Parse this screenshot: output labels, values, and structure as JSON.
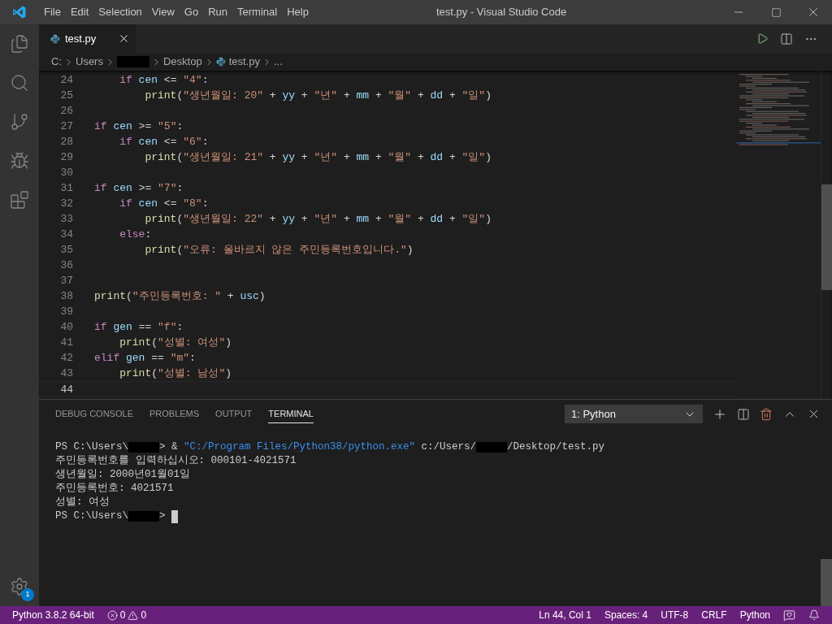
{
  "window": {
    "title": "test.py - Visual Studio Code"
  },
  "menu": [
    "File",
    "Edit",
    "Selection",
    "View",
    "Go",
    "Run",
    "Terminal",
    "Help"
  ],
  "activity_bar": {
    "items": [
      {
        "kind": "explorer"
      },
      {
        "kind": "search"
      },
      {
        "kind": "source_control"
      },
      {
        "kind": "run"
      },
      {
        "kind": "extensions"
      }
    ],
    "settings_badge": "1"
  },
  "editor_tabs": [
    {
      "label": "test.py",
      "selected": true
    }
  ],
  "breadcrumb": [
    {
      "kind": "text",
      "text": "C:"
    },
    {
      "kind": "text",
      "text": "Users"
    },
    {
      "kind": "redacted"
    },
    {
      "kind": "text",
      "text": "Desktop"
    },
    {
      "kind": "file",
      "text": "test.py"
    },
    {
      "kind": "text",
      "text": "..."
    }
  ],
  "code": [
    {
      "number": "24",
      "tokens": [
        {
          "kind": "indent"
        },
        {
          "kind": "keyword",
          "text": "if"
        },
        {
          "kind": "var",
          "text": " cen "
        },
        {
          "kind": "plain",
          "text": "<= "
        },
        {
          "kind": "string",
          "text": "\"4\""
        },
        {
          "kind": "plain",
          "text": ":"
        }
      ]
    },
    {
      "number": "25",
      "tokens": [
        {
          "kind": "indent"
        },
        {
          "kind": "indent"
        },
        {
          "kind": "func",
          "text": "print"
        },
        {
          "kind": "plain",
          "text": "("
        },
        {
          "kind": "string",
          "text": "\"생년월일: 20\""
        },
        {
          "kind": "plain",
          "text": " + "
        },
        {
          "kind": "var",
          "text": "yy"
        },
        {
          "kind": "plain",
          "text": " + "
        },
        {
          "kind": "string",
          "text": "\"년\""
        },
        {
          "kind": "plain",
          "text": " + "
        },
        {
          "kind": "var",
          "text": "mm"
        },
        {
          "kind": "plain",
          "text": " + "
        },
        {
          "kind": "string",
          "text": "\"월\""
        },
        {
          "kind": "plain",
          "text": " + "
        },
        {
          "kind": "var",
          "text": "dd"
        },
        {
          "kind": "plain",
          "text": " + "
        },
        {
          "kind": "string",
          "text": "\"일\""
        },
        {
          "kind": "plain",
          "text": ")"
        }
      ]
    },
    {
      "number": "26"
    },
    {
      "number": "27",
      "tokens": [
        {
          "kind": "keyword",
          "text": "if"
        },
        {
          "kind": "var",
          "text": " cen "
        },
        {
          "kind": "plain",
          "text": ">= "
        },
        {
          "kind": "string",
          "text": "\"5\""
        },
        {
          "kind": "plain",
          "text": ":"
        }
      ]
    },
    {
      "number": "28",
      "tokens": [
        {
          "kind": "indent"
        },
        {
          "kind": "keyword",
          "text": "if"
        },
        {
          "kind": "var",
          "text": " cen "
        },
        {
          "kind": "plain",
          "text": "<= "
        },
        {
          "kind": "string",
          "text": "\"6\""
        },
        {
          "kind": "plain",
          "text": ":"
        }
      ]
    },
    {
      "number": "29",
      "tokens": [
        {
          "kind": "indent"
        },
        {
          "kind": "indent"
        },
        {
          "kind": "func",
          "text": "print"
        },
        {
          "kind": "plain",
          "text": "("
        },
        {
          "kind": "string",
          "text": "\"생년월일: 21\""
        },
        {
          "kind": "plain",
          "text": " + "
        },
        {
          "kind": "var",
          "text": "yy"
        },
        {
          "kind": "plain",
          "text": " + "
        },
        {
          "kind": "string",
          "text": "\"년\""
        },
        {
          "kind": "plain",
          "text": " + "
        },
        {
          "kind": "var",
          "text": "mm"
        },
        {
          "kind": "plain",
          "text": " + "
        },
        {
          "kind": "string",
          "text": "\"월\""
        },
        {
          "kind": "plain",
          "text": " + "
        },
        {
          "kind": "var",
          "text": "dd"
        },
        {
          "kind": "plain",
          "text": " + "
        },
        {
          "kind": "string",
          "text": "\"일\""
        },
        {
          "kind": "plain",
          "text": ")"
        }
      ]
    },
    {
      "number": "30"
    },
    {
      "number": "31",
      "tokens": [
        {
          "kind": "keyword",
          "text": "if"
        },
        {
          "kind": "var",
          "text": " cen "
        },
        {
          "kind": "plain",
          "text": ">= "
        },
        {
          "kind": "string",
          "text": "\"7\""
        },
        {
          "kind": "plain",
          "text": ":"
        }
      ]
    },
    {
      "number": "32",
      "tokens": [
        {
          "kind": "indent"
        },
        {
          "kind": "keyword",
          "text": "if"
        },
        {
          "kind": "var",
          "text": " cen "
        },
        {
          "kind": "plain",
          "text": "<= "
        },
        {
          "kind": "string",
          "text": "\"8\""
        },
        {
          "kind": "plain",
          "text": ":"
        }
      ]
    },
    {
      "number": "33",
      "tokens": [
        {
          "kind": "indent"
        },
        {
          "kind": "indent"
        },
        {
          "kind": "func",
          "text": "print"
        },
        {
          "kind": "plain",
          "text": "("
        },
        {
          "kind": "string",
          "text": "\"생년월일: 22\""
        },
        {
          "kind": "plain",
          "text": " + "
        },
        {
          "kind": "var",
          "text": "yy"
        },
        {
          "kind": "plain",
          "text": " + "
        },
        {
          "kind": "string",
          "text": "\"년\""
        },
        {
          "kind": "plain",
          "text": " + "
        },
        {
          "kind": "var",
          "text": "mm"
        },
        {
          "kind": "plain",
          "text": " + "
        },
        {
          "kind": "string",
          "text": "\"월\""
        },
        {
          "kind": "plain",
          "text": " + "
        },
        {
          "kind": "var",
          "text": "dd"
        },
        {
          "kind": "plain",
          "text": " + "
        },
        {
          "kind": "string",
          "text": "\"일\""
        },
        {
          "kind": "plain",
          "text": ")"
        }
      ]
    },
    {
      "number": "34",
      "tokens": [
        {
          "kind": "indent"
        },
        {
          "kind": "keyword",
          "text": "else"
        },
        {
          "kind": "plain",
          "text": ":"
        }
      ]
    },
    {
      "number": "35",
      "tokens": [
        {
          "kind": "indent"
        },
        {
          "kind": "indent"
        },
        {
          "kind": "func",
          "text": "print"
        },
        {
          "kind": "plain",
          "text": "("
        },
        {
          "kind": "string",
          "text": "\"오류: 올바르지 않은 주민등록번호입니다.\""
        },
        {
          "kind": "plain",
          "text": ")"
        }
      ]
    },
    {
      "number": "36"
    },
    {
      "number": "37"
    },
    {
      "number": "38",
      "tokens": [
        {
          "kind": "func",
          "text": "print"
        },
        {
          "kind": "plain",
          "text": "("
        },
        {
          "kind": "string",
          "text": "\"주민등록번호: \""
        },
        {
          "kind": "plain",
          "text": " + "
        },
        {
          "kind": "var",
          "text": "usc"
        },
        {
          "kind": "plain",
          "text": ")"
        }
      ]
    },
    {
      "number": "39"
    },
    {
      "number": "40",
      "tokens": [
        {
          "kind": "keyword",
          "text": "if"
        },
        {
          "kind": "var",
          "text": " gen "
        },
        {
          "kind": "plain",
          "text": "== "
        },
        {
          "kind": "string",
          "text": "\"f\""
        },
        {
          "kind": "plain",
          "text": ":"
        }
      ]
    },
    {
      "number": "41",
      "tokens": [
        {
          "kind": "indent"
        },
        {
          "kind": "func",
          "text": "print"
        },
        {
          "kind": "plain",
          "text": "("
        },
        {
          "kind": "string",
          "text": "\"성별: 여성\""
        },
        {
          "kind": "plain",
          "text": ")"
        }
      ]
    },
    {
      "number": "42",
      "tokens": [
        {
          "kind": "keyword",
          "text": "elif"
        },
        {
          "kind": "var",
          "text": " gen "
        },
        {
          "kind": "plain",
          "text": "== "
        },
        {
          "kind": "string",
          "text": "\"m\""
        },
        {
          "kind": "plain",
          "text": ":"
        }
      ]
    },
    {
      "number": "43",
      "tokens": [
        {
          "kind": "indent"
        },
        {
          "kind": "func",
          "text": "print"
        },
        {
          "kind": "plain",
          "text": "("
        },
        {
          "kind": "string",
          "text": "\"성별: 남성\""
        },
        {
          "kind": "plain",
          "text": ")"
        }
      ]
    },
    {
      "number": "44",
      "current": true
    }
  ],
  "panel": {
    "tabs": [
      {
        "label": "DEBUG CONSOLE",
        "selected": false
      },
      {
        "label": "PROBLEMS",
        "selected": false
      },
      {
        "label": "OUTPUT",
        "selected": false
      },
      {
        "label": "TERMINAL",
        "selected": true
      }
    ],
    "terminal_select": "1: Python",
    "terminal": [
      [
        {
          "kind": "text",
          "text": "PS C:\\Users\\"
        },
        {
          "kind": "redacted"
        },
        {
          "kind": "text",
          "text": "> & "
        },
        {
          "kind": "string",
          "text": "\"C:/Program Files/Python38/python.exe\""
        },
        {
          "kind": "text",
          "text": " c:/Users/"
        },
        {
          "kind": "redacted"
        },
        {
          "kind": "text",
          "text": "/Desktop/test.py"
        }
      ],
      [
        {
          "kind": "text",
          "text": "주민등록번호를 입력하십시오: 000101-4021571"
        }
      ],
      [
        {
          "kind": "text",
          "text": "생년월일: 2000년01월01일"
        }
      ],
      [
        {
          "kind": "text",
          "text": "주민등록번호: 4021571"
        }
      ],
      [
        {
          "kind": "text",
          "text": "성별: 여성"
        }
      ],
      [
        {
          "kind": "text",
          "text": "PS C:\\Users\\"
        },
        {
          "kind": "redacted"
        },
        {
          "kind": "text",
          "text": "> "
        },
        {
          "kind": "cursor"
        }
      ]
    ]
  },
  "status_bar": {
    "interpreter": "Python 3.8.2 64-bit",
    "errors": "0",
    "warnings": "0",
    "position": "Ln 44, Col 1",
    "indent": "Spaces: 4",
    "encoding": "UTF-8",
    "eol": "CRLF",
    "language": "Python"
  }
}
